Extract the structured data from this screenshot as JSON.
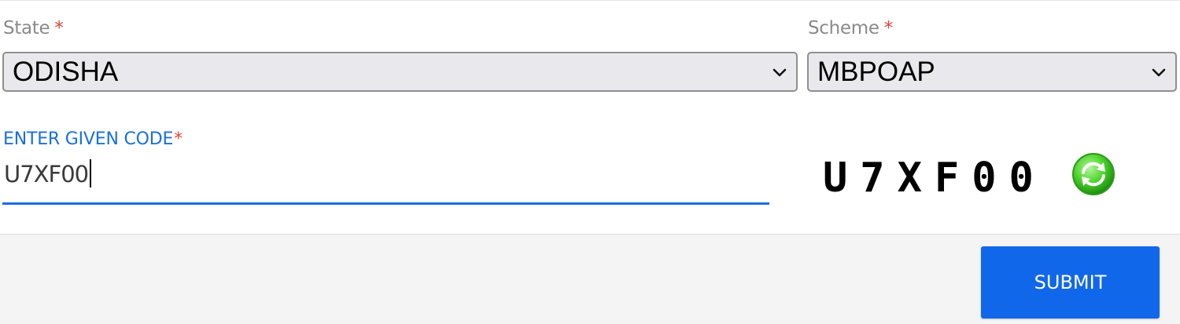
{
  "form": {
    "state": {
      "label": "State",
      "required_mark": "*",
      "value": "ODISHA"
    },
    "scheme": {
      "label": "Scheme",
      "required_mark": "*",
      "value": "MBPOAP"
    },
    "code": {
      "label": "ENTER GIVEN CODE",
      "required_mark": "*",
      "value": "U7XF00"
    },
    "captcha": {
      "text": "U7XF00",
      "refresh_icon": "refresh-icon"
    }
  },
  "footer": {
    "submit_label": "SUBMIT"
  },
  "colors": {
    "accent": "#1a6fe0",
    "submit": "#1167ea",
    "required": "#e0453a",
    "refresh": "#3cc43c"
  }
}
